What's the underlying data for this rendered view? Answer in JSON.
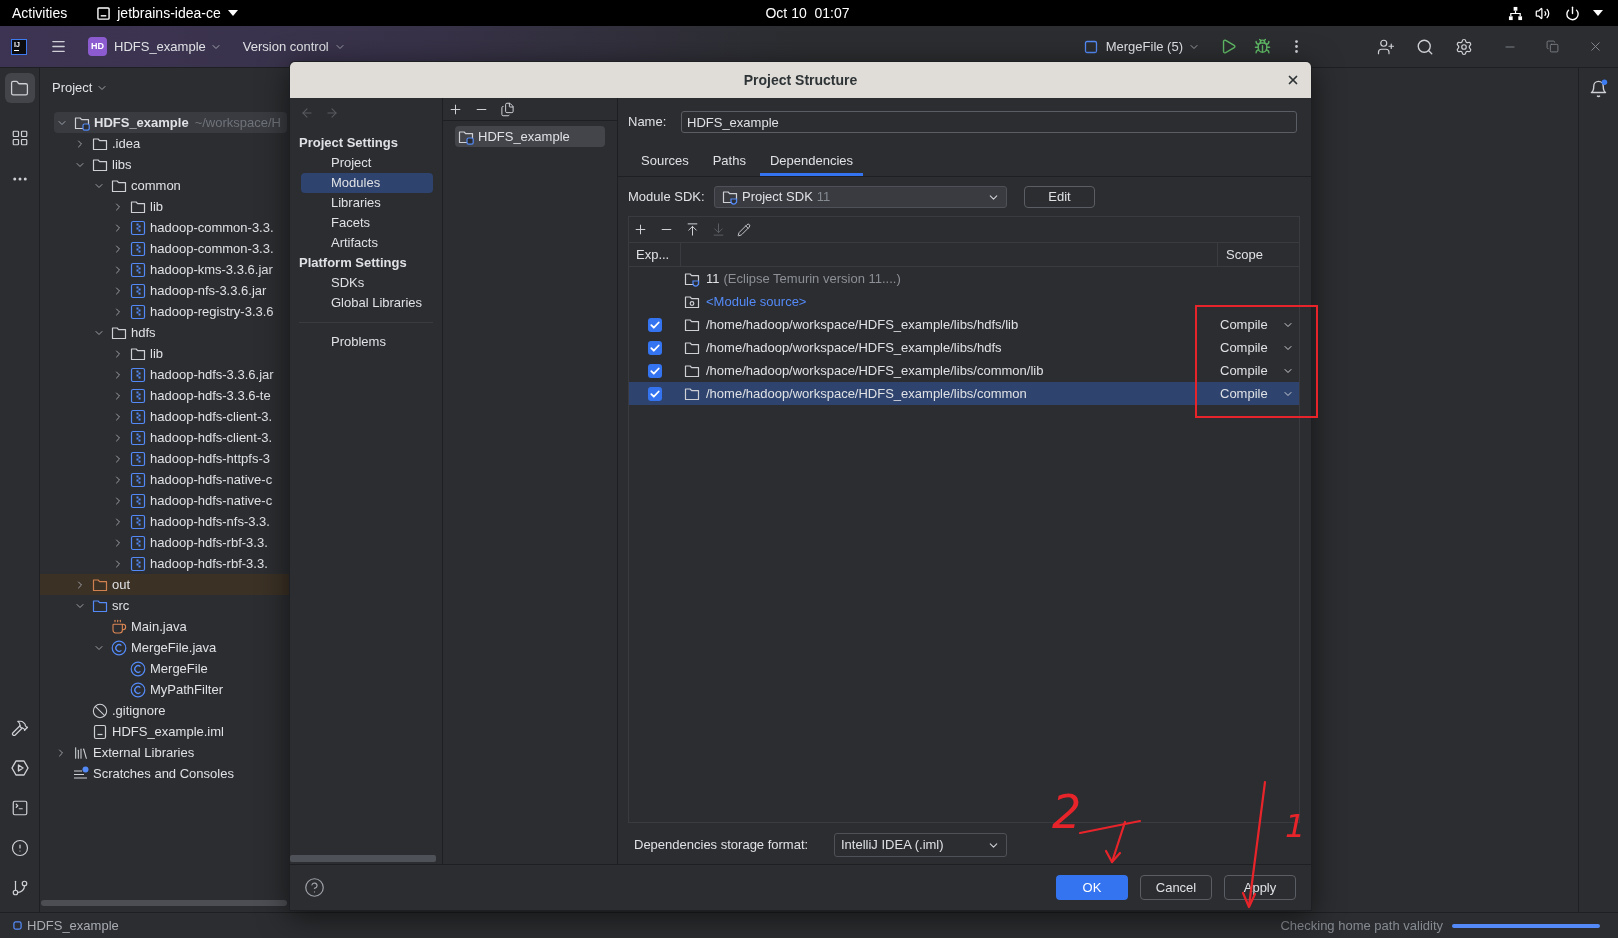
{
  "system_bar": {
    "activities": "Activities",
    "app_menu": "jetbrains-idea-ce",
    "clock": "Oct 10  01:07"
  },
  "toolbar": {
    "logo_text": "IJ",
    "project_badge": "HD",
    "project": "HDFS_example",
    "vcs": "Version control",
    "run_config": "MergeFile (5)"
  },
  "project_panel": {
    "title": "Project",
    "tree": [
      {
        "label": "HDFS_example",
        "path": "~/workspace/H",
        "kind": "module",
        "expanded": true,
        "selected": true,
        "children": [
          {
            "label": ".idea",
            "kind": "folder",
            "expanded": false,
            "selected": false
          },
          {
            "label": "libs",
            "kind": "folder",
            "expanded": true,
            "selected": false,
            "children": [
              {
                "label": "common",
                "kind": "folder",
                "expanded": true,
                "selected": false,
                "children": [
                  {
                    "label": "lib",
                    "kind": "folder",
                    "expanded": false,
                    "selected": false
                  },
                  {
                    "label": "hadoop-common-3.3.",
                    "kind": "jar",
                    "expanded": false,
                    "selected": false
                  },
                  {
                    "label": "hadoop-common-3.3.",
                    "kind": "jar",
                    "expanded": false,
                    "selected": false
                  },
                  {
                    "label": "hadoop-kms-3.3.6.jar",
                    "kind": "jar",
                    "expanded": false,
                    "selected": false
                  },
                  {
                    "label": "hadoop-nfs-3.3.6.jar",
                    "kind": "jar",
                    "expanded": false,
                    "selected": false
                  },
                  {
                    "label": "hadoop-registry-3.3.6",
                    "kind": "jar",
                    "expanded": false,
                    "selected": false
                  }
                ]
              },
              {
                "label": "hdfs",
                "kind": "folder",
                "expanded": true,
                "selected": false,
                "children": [
                  {
                    "label": "lib",
                    "kind": "folder",
                    "expanded": false,
                    "selected": false
                  },
                  {
                    "label": "hadoop-hdfs-3.3.6.jar",
                    "kind": "jar",
                    "expanded": false,
                    "selected": false
                  },
                  {
                    "label": "hadoop-hdfs-3.3.6-te",
                    "kind": "jar",
                    "expanded": false,
                    "selected": false
                  },
                  {
                    "label": "hadoop-hdfs-client-3.",
                    "kind": "jar",
                    "expanded": false,
                    "selected": false
                  },
                  {
                    "label": "hadoop-hdfs-client-3.",
                    "kind": "jar",
                    "expanded": false,
                    "selected": false
                  },
                  {
                    "label": "hadoop-hdfs-httpfs-3",
                    "kind": "jar",
                    "expanded": false,
                    "selected": false
                  },
                  {
                    "label": "hadoop-hdfs-native-c",
                    "kind": "jar",
                    "expanded": false,
                    "selected": false
                  },
                  {
                    "label": "hadoop-hdfs-native-c",
                    "kind": "jar",
                    "expanded": false,
                    "selected": false
                  },
                  {
                    "label": "hadoop-hdfs-nfs-3.3.",
                    "kind": "jar",
                    "expanded": false,
                    "selected": false
                  },
                  {
                    "label": "hadoop-hdfs-rbf-3.3.",
                    "kind": "jar",
                    "expanded": false,
                    "selected": false
                  },
                  {
                    "label": "hadoop-hdfs-rbf-3.3.",
                    "kind": "jar",
                    "expanded": false,
                    "selected": false
                  }
                ]
              }
            ]
          },
          {
            "label": "out",
            "kind": "excluded-folder",
            "expanded": false,
            "selected": false
          },
          {
            "label": "src",
            "kind": "source-folder",
            "expanded": true,
            "selected": false,
            "children": [
              {
                "label": "Main.java",
                "kind": "java-file",
                "selected": false
              },
              {
                "label": "MergeFile.java",
                "kind": "class",
                "expanded": true,
                "selected": false,
                "children": [
                  {
                    "label": "MergeFile",
                    "kind": "class",
                    "selected": false
                  },
                  {
                    "label": "MyPathFilter",
                    "kind": "class",
                    "selected": false
                  }
                ]
              }
            ]
          },
          {
            "label": ".gitignore",
            "kind": "ignore-file",
            "selected": false
          },
          {
            "label": "HDFS_example.iml",
            "kind": "module-file",
            "selected": false
          }
        ]
      },
      {
        "label": "External Libraries",
        "kind": "libraries",
        "expanded": false,
        "selected": false
      },
      {
        "label": "Scratches and Consoles",
        "kind": "scratches",
        "selected": false
      }
    ]
  },
  "dialog": {
    "title": "Project Structure",
    "nav": [
      {
        "title": "Project Settings",
        "items": [
          {
            "label": "Project",
            "selected": false
          },
          {
            "label": "Modules",
            "selected": true
          },
          {
            "label": "Libraries",
            "selected": false
          },
          {
            "label": "Facets",
            "selected": false
          },
          {
            "label": "Artifacts",
            "selected": false
          }
        ]
      },
      {
        "title": "Platform Settings",
        "items": [
          {
            "label": "SDKs",
            "selected": false
          },
          {
            "label": "Global Libraries",
            "selected": false
          }
        ]
      },
      {
        "items": [
          {
            "label": "Problems",
            "selected": false
          }
        ]
      }
    ],
    "modules": [
      {
        "label": "HDFS_example",
        "selected": true
      }
    ],
    "name": {
      "label": "Name:",
      "value": "HDFS_example"
    },
    "tabs": [
      {
        "label": "Sources",
        "selected": false
      },
      {
        "label": "Paths",
        "selected": false
      },
      {
        "label": "Dependencies",
        "selected": true
      }
    ],
    "sdk": {
      "label": "Module SDK:",
      "value": "Project SDK",
      "version": "11",
      "edit": "Edit"
    },
    "dependencies": {
      "columns": {
        "column_1": "Exp...",
        "scope": "Scope"
      },
      "rows": [
        {
          "kind": "sdk",
          "name": "11",
          "detail": "(Eclipse Temurin version 11....)",
          "selected": false
        },
        {
          "kind": "module-source",
          "name": "<Module source>",
          "selected": false
        },
        {
          "kind": "library",
          "exported": true,
          "name": "/home/hadoop/workspace/HDFS_example/libs/hdfs/lib",
          "scope": "Compile",
          "selected": false
        },
        {
          "kind": "library",
          "exported": true,
          "name": "/home/hadoop/workspace/HDFS_example/libs/hdfs",
          "scope": "Compile",
          "selected": false
        },
        {
          "kind": "library",
          "exported": true,
          "name": "/home/hadoop/workspace/HDFS_example/libs/common/lib",
          "scope": "Compile",
          "selected": false
        },
        {
          "kind": "library",
          "exported": true,
          "name": "/home/hadoop/workspace/HDFS_example/libs/common",
          "scope": "Compile",
          "selected": true
        }
      ]
    },
    "storage": {
      "label": "Dependencies storage format:",
      "value": "IntelliJ IDEA (.iml)"
    },
    "buttons": [
      {
        "label": "OK",
        "kind": "primary"
      },
      {
        "label": "Cancel",
        "kind": "secondary"
      },
      {
        "label": "Apply",
        "kind": "secondary"
      }
    ]
  },
  "status_bar": {
    "project": "HDFS_example",
    "task": "Checking home path validity"
  },
  "annotations": {
    "steps": [
      {
        "label": "2"
      },
      {
        "label": "1"
      }
    ]
  }
}
